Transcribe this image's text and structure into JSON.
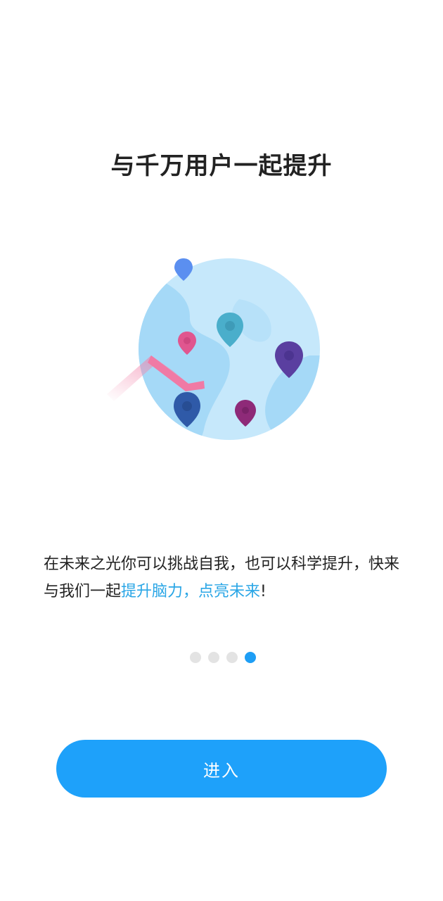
{
  "page": {
    "title": "与千万用户一起提升",
    "description": {
      "part1": "在未来之光你可以挑战自我，也可以科学提升",
      "part2": "，快来与我们一起",
      "highlight": "提升脑力，点亮未来",
      "end": "!"
    },
    "pagination": {
      "total": 4,
      "active_index": 3
    },
    "enter_button": "进入"
  },
  "illustration": {
    "icon": "globe-with-map-pins-illustration",
    "pin_colors": [
      "#5b8ff0",
      "#4aaecb",
      "#e0568f",
      "#5a3fa0",
      "#2f5aa8",
      "#8e2a78"
    ]
  },
  "colors": {
    "accent": "#1ea1fa",
    "highlight_text": "#2aa6e6",
    "dot_inactive": "#e3e3e3"
  }
}
